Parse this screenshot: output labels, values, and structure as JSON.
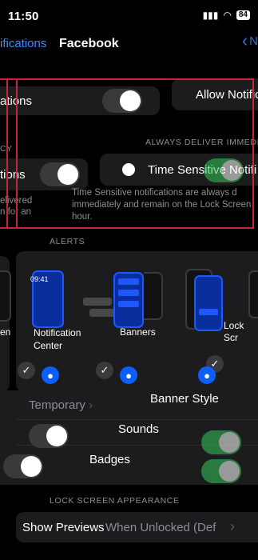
{
  "status_bar": {
    "time": "11:50",
    "battery": "84"
  },
  "nav": {
    "back_label": "ifications",
    "title": "Facebook",
    "right_label": "N"
  },
  "top_rows": {
    "allow_ghost_label": "ations",
    "allow_label": "Allow Notific",
    "section_header_left": "CY",
    "always_deliver_header": "ALWAYS DELIVER IMMEDIA",
    "time_sensitive_ghost_label": "tions",
    "time_sensitive_label": "Time Sensitive Notifi",
    "ghost_caption_1": "elivered",
    "ghost_caption_2": "n for an",
    "time_sensitive_caption": "Time Sensitive notifications are always d immediately and remain on the Lock Screen hour."
  },
  "alerts": {
    "header": "ALERTS",
    "preview_time": "09:41",
    "lock_screen_left": "en",
    "notification_center": "Notification Center",
    "banners": "Banners",
    "lock_screen": "Lock Scr"
  },
  "banner_rows": {
    "temporary_label": "Temporary",
    "banner_style_label": "Banner Style",
    "sounds_label": "Sounds",
    "badges_label": "Badges"
  },
  "lock_screen_appearance": {
    "header": "LOCK SCREEN APPEARANCE",
    "show_previews_label": "Show Previews",
    "show_previews_value": "When Unlocked (Def"
  },
  "colors": {
    "accent": "#3d8bff",
    "toggle_on": "#34c759",
    "highlight": "#c4263a",
    "check_on": "#0b5fff"
  }
}
